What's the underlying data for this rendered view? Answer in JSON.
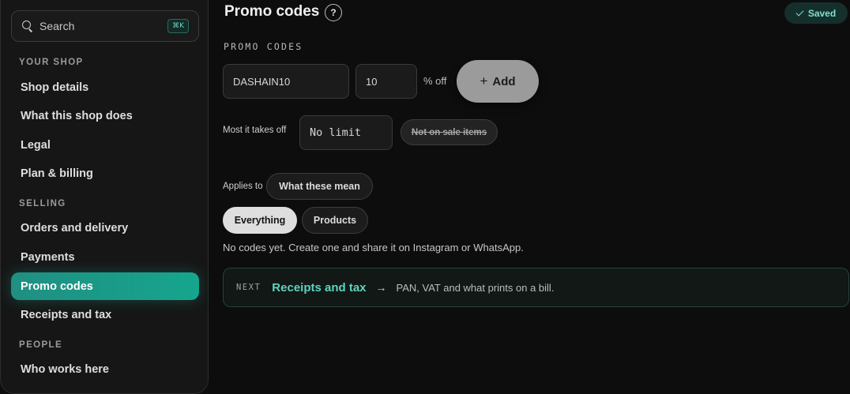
{
  "sidebar": {
    "search": {
      "label": "Search",
      "shortcut": "⌘K"
    },
    "sections": [
      {
        "title": "YOUR SHOP",
        "items": [
          "Shop details",
          "What this shop does",
          "Legal",
          "Plan & billing"
        ]
      },
      {
        "title": "SELLING",
        "items": [
          "Orders and delivery",
          "Payments",
          "Promo codes",
          "Receipts and tax"
        ]
      },
      {
        "title": "PEOPLE",
        "items": [
          "Who works here"
        ]
      }
    ],
    "active_item": "Promo codes"
  },
  "header": {
    "title": "Promo codes",
    "help_glyph": "?",
    "saved_label": "Saved"
  },
  "promo": {
    "section_label": "PROMO CODES",
    "code_value": "DASHAIN10",
    "percent_value": "10",
    "percent_suffix": "% off",
    "add_label": "Add",
    "add_glyph": "+",
    "max_label": "Most it takes off",
    "max_value": "No limit",
    "not_on_sale_label": "Not on sale items",
    "applies_label": "Applies to",
    "what_these_mean_label": "What these mean",
    "scope_options": [
      "Everything",
      "Products"
    ],
    "scope_selected": "Everything",
    "empty_message": "No codes yet. Create one and share it on Instagram or WhatsApp."
  },
  "next_step": {
    "tag": "NEXT",
    "link_label": "Receipts and tax",
    "arrow": "→",
    "description": "PAN, VAT and what prints on a bill."
  },
  "colors": {
    "accent": "#1aa08c",
    "link": "#5fd3bd",
    "background": "#0d0d0d"
  }
}
